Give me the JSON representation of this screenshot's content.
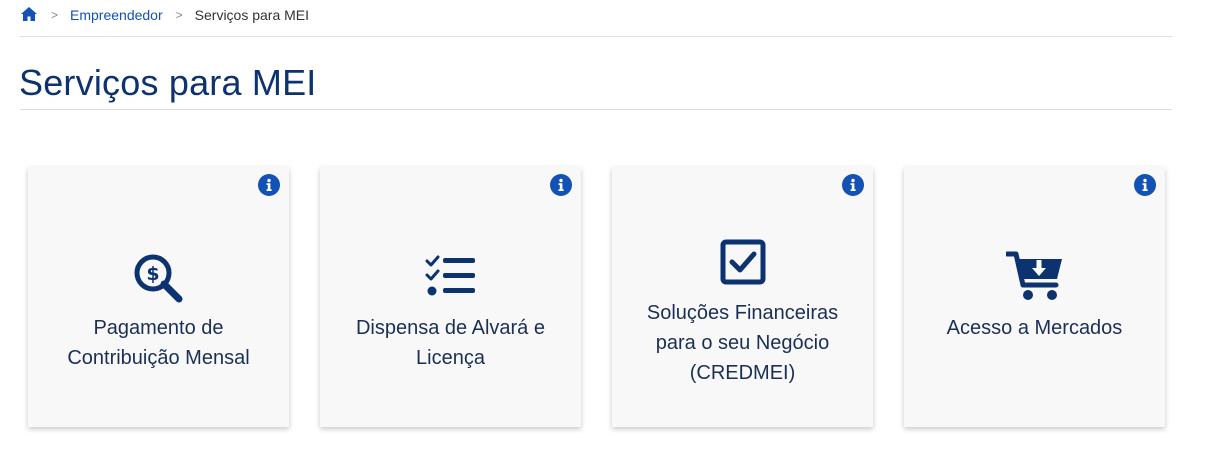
{
  "breadcrumb": {
    "home_icon": "home-icon",
    "separator": ">",
    "items": [
      {
        "label": "Empreendedor"
      },
      {
        "label": "Serviços para MEI"
      }
    ]
  },
  "page": {
    "title": "Serviços para MEI"
  },
  "colors": {
    "primary_blue": "#1351b4",
    "title_navy": "#0c326f",
    "icon_navy": "#0c326f",
    "card_bg": "#f8f8f8"
  },
  "cards": [
    {
      "icon": "dollar-search-icon",
      "label": "Pagamento de Contribuição Mensal",
      "info_icon": "info-icon"
    },
    {
      "icon": "checklist-icon",
      "label": "Dispensa de Alvará e Licença",
      "info_icon": "info-icon"
    },
    {
      "icon": "checkbox-icon",
      "label": "Soluções Financeiras para o seu Negócio (CREDMEI)",
      "info_icon": "info-icon"
    },
    {
      "icon": "cart-download-icon",
      "label": "Acesso a Mercados",
      "info_icon": "info-icon"
    }
  ]
}
